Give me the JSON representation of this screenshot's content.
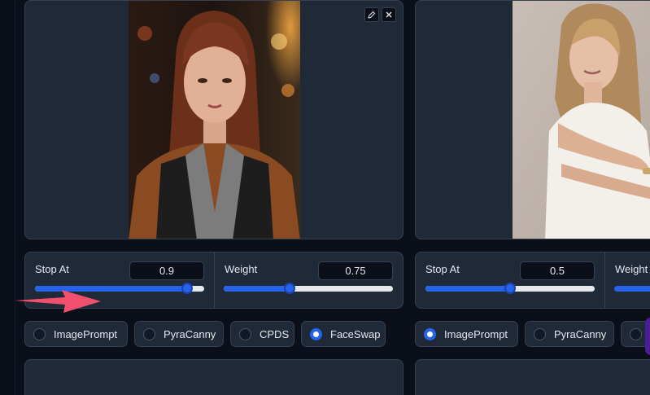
{
  "colors": {
    "page_bg": "#0b0f19",
    "panel_bg": "#1f2937",
    "border": "#374151",
    "accent": "#2563eb",
    "arrow": "#f0506e"
  },
  "left": {
    "image": {
      "edit_icon": "pencil-icon",
      "close_icon": "close-icon",
      "subject": "portrait of a young woman with bangs in a brown leather jacket, city lights behind"
    },
    "stop_at": {
      "label": "Stop At",
      "value": "0.9",
      "fraction": 0.9
    },
    "weight": {
      "label": "Weight",
      "value": "0.75",
      "fraction": 0.39
    },
    "radios": [
      {
        "label": "ImagePrompt",
        "selected": false
      },
      {
        "label": "PyraCanny",
        "selected": false
      },
      {
        "label": "CPDS",
        "selected": false
      },
      {
        "label": "FaceSwap",
        "selected": true
      }
    ]
  },
  "right": {
    "image": {
      "subject": "blonde woman in a white top with crossed arms on a light background"
    },
    "stop_at": {
      "label": "Stop At",
      "value": "0.5",
      "fraction": 0.5
    },
    "weight": {
      "label": "Weight"
    },
    "radios": [
      {
        "label": "ImagePrompt",
        "selected": true
      },
      {
        "label": "PyraCanny",
        "selected": false
      }
    ]
  }
}
